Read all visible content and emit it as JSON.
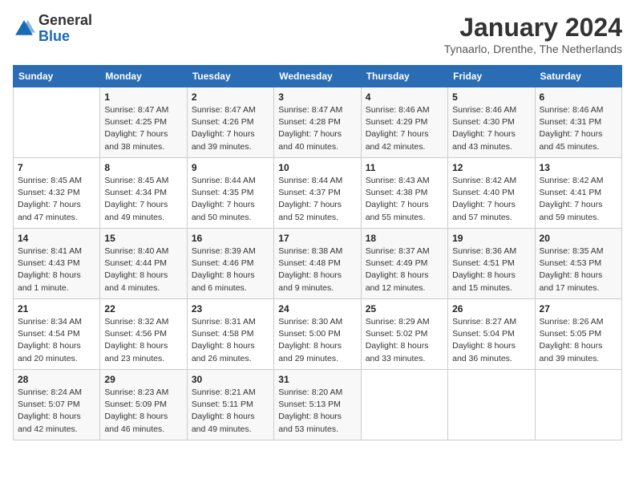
{
  "header": {
    "logo_general": "General",
    "logo_blue": "Blue",
    "month": "January 2024",
    "location": "Tynaarlo, Drenthe, The Netherlands"
  },
  "days_of_week": [
    "Sunday",
    "Monday",
    "Tuesday",
    "Wednesday",
    "Thursday",
    "Friday",
    "Saturday"
  ],
  "weeks": [
    [
      {
        "day": "",
        "sunrise": "",
        "sunset": "",
        "daylight": ""
      },
      {
        "day": "1",
        "sunrise": "Sunrise: 8:47 AM",
        "sunset": "Sunset: 4:25 PM",
        "daylight": "Daylight: 7 hours and 38 minutes."
      },
      {
        "day": "2",
        "sunrise": "Sunrise: 8:47 AM",
        "sunset": "Sunset: 4:26 PM",
        "daylight": "Daylight: 7 hours and 39 minutes."
      },
      {
        "day": "3",
        "sunrise": "Sunrise: 8:47 AM",
        "sunset": "Sunset: 4:28 PM",
        "daylight": "Daylight: 7 hours and 40 minutes."
      },
      {
        "day": "4",
        "sunrise": "Sunrise: 8:46 AM",
        "sunset": "Sunset: 4:29 PM",
        "daylight": "Daylight: 7 hours and 42 minutes."
      },
      {
        "day": "5",
        "sunrise": "Sunrise: 8:46 AM",
        "sunset": "Sunset: 4:30 PM",
        "daylight": "Daylight: 7 hours and 43 minutes."
      },
      {
        "day": "6",
        "sunrise": "Sunrise: 8:46 AM",
        "sunset": "Sunset: 4:31 PM",
        "daylight": "Daylight: 7 hours and 45 minutes."
      }
    ],
    [
      {
        "day": "7",
        "sunrise": "Sunrise: 8:45 AM",
        "sunset": "Sunset: 4:32 PM",
        "daylight": "Daylight: 7 hours and 47 minutes."
      },
      {
        "day": "8",
        "sunrise": "Sunrise: 8:45 AM",
        "sunset": "Sunset: 4:34 PM",
        "daylight": "Daylight: 7 hours and 49 minutes."
      },
      {
        "day": "9",
        "sunrise": "Sunrise: 8:44 AM",
        "sunset": "Sunset: 4:35 PM",
        "daylight": "Daylight: 7 hours and 50 minutes."
      },
      {
        "day": "10",
        "sunrise": "Sunrise: 8:44 AM",
        "sunset": "Sunset: 4:37 PM",
        "daylight": "Daylight: 7 hours and 52 minutes."
      },
      {
        "day": "11",
        "sunrise": "Sunrise: 8:43 AM",
        "sunset": "Sunset: 4:38 PM",
        "daylight": "Daylight: 7 hours and 55 minutes."
      },
      {
        "day": "12",
        "sunrise": "Sunrise: 8:42 AM",
        "sunset": "Sunset: 4:40 PM",
        "daylight": "Daylight: 7 hours and 57 minutes."
      },
      {
        "day": "13",
        "sunrise": "Sunrise: 8:42 AM",
        "sunset": "Sunset: 4:41 PM",
        "daylight": "Daylight: 7 hours and 59 minutes."
      }
    ],
    [
      {
        "day": "14",
        "sunrise": "Sunrise: 8:41 AM",
        "sunset": "Sunset: 4:43 PM",
        "daylight": "Daylight: 8 hours and 1 minute."
      },
      {
        "day": "15",
        "sunrise": "Sunrise: 8:40 AM",
        "sunset": "Sunset: 4:44 PM",
        "daylight": "Daylight: 8 hours and 4 minutes."
      },
      {
        "day": "16",
        "sunrise": "Sunrise: 8:39 AM",
        "sunset": "Sunset: 4:46 PM",
        "daylight": "Daylight: 8 hours and 6 minutes."
      },
      {
        "day": "17",
        "sunrise": "Sunrise: 8:38 AM",
        "sunset": "Sunset: 4:48 PM",
        "daylight": "Daylight: 8 hours and 9 minutes."
      },
      {
        "day": "18",
        "sunrise": "Sunrise: 8:37 AM",
        "sunset": "Sunset: 4:49 PM",
        "daylight": "Daylight: 8 hours and 12 minutes."
      },
      {
        "day": "19",
        "sunrise": "Sunrise: 8:36 AM",
        "sunset": "Sunset: 4:51 PM",
        "daylight": "Daylight: 8 hours and 15 minutes."
      },
      {
        "day": "20",
        "sunrise": "Sunrise: 8:35 AM",
        "sunset": "Sunset: 4:53 PM",
        "daylight": "Daylight: 8 hours and 17 minutes."
      }
    ],
    [
      {
        "day": "21",
        "sunrise": "Sunrise: 8:34 AM",
        "sunset": "Sunset: 4:54 PM",
        "daylight": "Daylight: 8 hours and 20 minutes."
      },
      {
        "day": "22",
        "sunrise": "Sunrise: 8:32 AM",
        "sunset": "Sunset: 4:56 PM",
        "daylight": "Daylight: 8 hours and 23 minutes."
      },
      {
        "day": "23",
        "sunrise": "Sunrise: 8:31 AM",
        "sunset": "Sunset: 4:58 PM",
        "daylight": "Daylight: 8 hours and 26 minutes."
      },
      {
        "day": "24",
        "sunrise": "Sunrise: 8:30 AM",
        "sunset": "Sunset: 5:00 PM",
        "daylight": "Daylight: 8 hours and 29 minutes."
      },
      {
        "day": "25",
        "sunrise": "Sunrise: 8:29 AM",
        "sunset": "Sunset: 5:02 PM",
        "daylight": "Daylight: 8 hours and 33 minutes."
      },
      {
        "day": "26",
        "sunrise": "Sunrise: 8:27 AM",
        "sunset": "Sunset: 5:04 PM",
        "daylight": "Daylight: 8 hours and 36 minutes."
      },
      {
        "day": "27",
        "sunrise": "Sunrise: 8:26 AM",
        "sunset": "Sunset: 5:05 PM",
        "daylight": "Daylight: 8 hours and 39 minutes."
      }
    ],
    [
      {
        "day": "28",
        "sunrise": "Sunrise: 8:24 AM",
        "sunset": "Sunset: 5:07 PM",
        "daylight": "Daylight: 8 hours and 42 minutes."
      },
      {
        "day": "29",
        "sunrise": "Sunrise: 8:23 AM",
        "sunset": "Sunset: 5:09 PM",
        "daylight": "Daylight: 8 hours and 46 minutes."
      },
      {
        "day": "30",
        "sunrise": "Sunrise: 8:21 AM",
        "sunset": "Sunset: 5:11 PM",
        "daylight": "Daylight: 8 hours and 49 minutes."
      },
      {
        "day": "31",
        "sunrise": "Sunrise: 8:20 AM",
        "sunset": "Sunset: 5:13 PM",
        "daylight": "Daylight: 8 hours and 53 minutes."
      },
      {
        "day": "",
        "sunrise": "",
        "sunset": "",
        "daylight": ""
      },
      {
        "day": "",
        "sunrise": "",
        "sunset": "",
        "daylight": ""
      },
      {
        "day": "",
        "sunrise": "",
        "sunset": "",
        "daylight": ""
      }
    ]
  ]
}
